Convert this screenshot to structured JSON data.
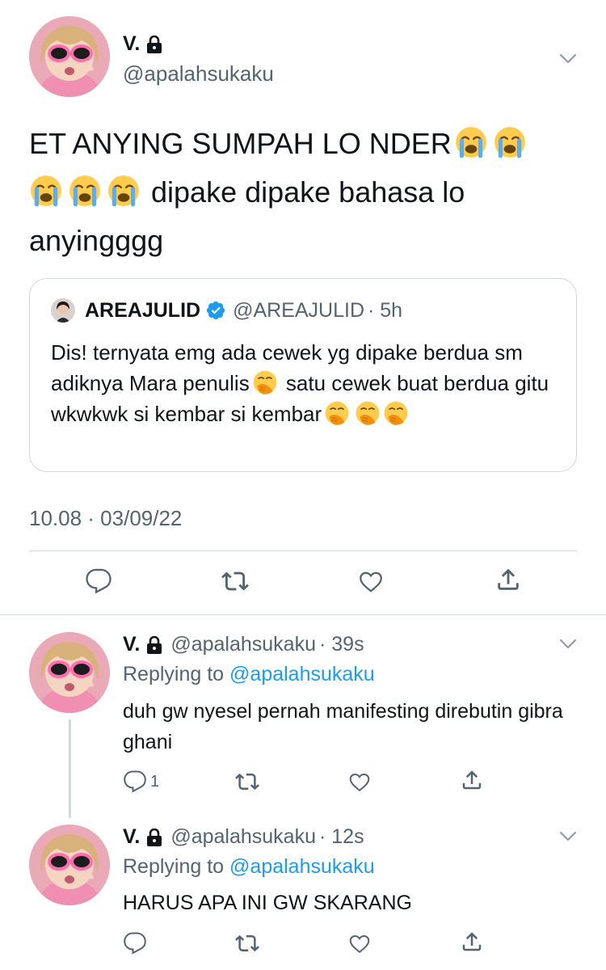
{
  "main_tweet": {
    "name": "V.",
    "handle": "@apalahsukaku",
    "text_part1": "ET ANYING SUMPAH LO NDER",
    "text_part2": " dipake dipake bahasa lo anyingggg",
    "timestamp": "10.08 · 03/09/22"
  },
  "quote": {
    "name": "AREAJULID",
    "handle": "@AREAJULID",
    "time": "· 5h",
    "text_part1": "Dis! ternyata emg ada cewek yg dipake berdua sm adiknya Mara penulis",
    "text_part2": " satu cewek buat berdua gitu wkwkwk si kembar si kembar"
  },
  "replies": [
    {
      "name": "V.",
      "handle": "@apalahsukaku",
      "time": "· 39s",
      "replying_prefix": "Replying to ",
      "replying_to": "@apalahsukaku",
      "text": "duh gw nyesel pernah manifesting direbutin gibra ghani",
      "reply_count": "1"
    },
    {
      "name": "V.",
      "handle": "@apalahsukaku",
      "time": "· 12s",
      "replying_prefix": "Replying to ",
      "replying_to": "@apalahsukaku",
      "text": "HARUS APA INI GW SKARANG",
      "reply_count": ""
    }
  ],
  "icons": {
    "lock": "lock-icon",
    "verified": "verified-badge-icon",
    "reply": "reply-icon",
    "retweet": "retweet-icon",
    "like": "like-icon",
    "share": "share-icon",
    "more": "chevron-down-icon",
    "crying_emoji": "loudly-crying-face-emoji",
    "hand_over_mouth_emoji": "face-with-hand-over-mouth-emoji"
  },
  "colors": {
    "text": "#0f1419",
    "secondary": "#536471",
    "link": "#1d9bf0",
    "border": "#cfd9de"
  }
}
